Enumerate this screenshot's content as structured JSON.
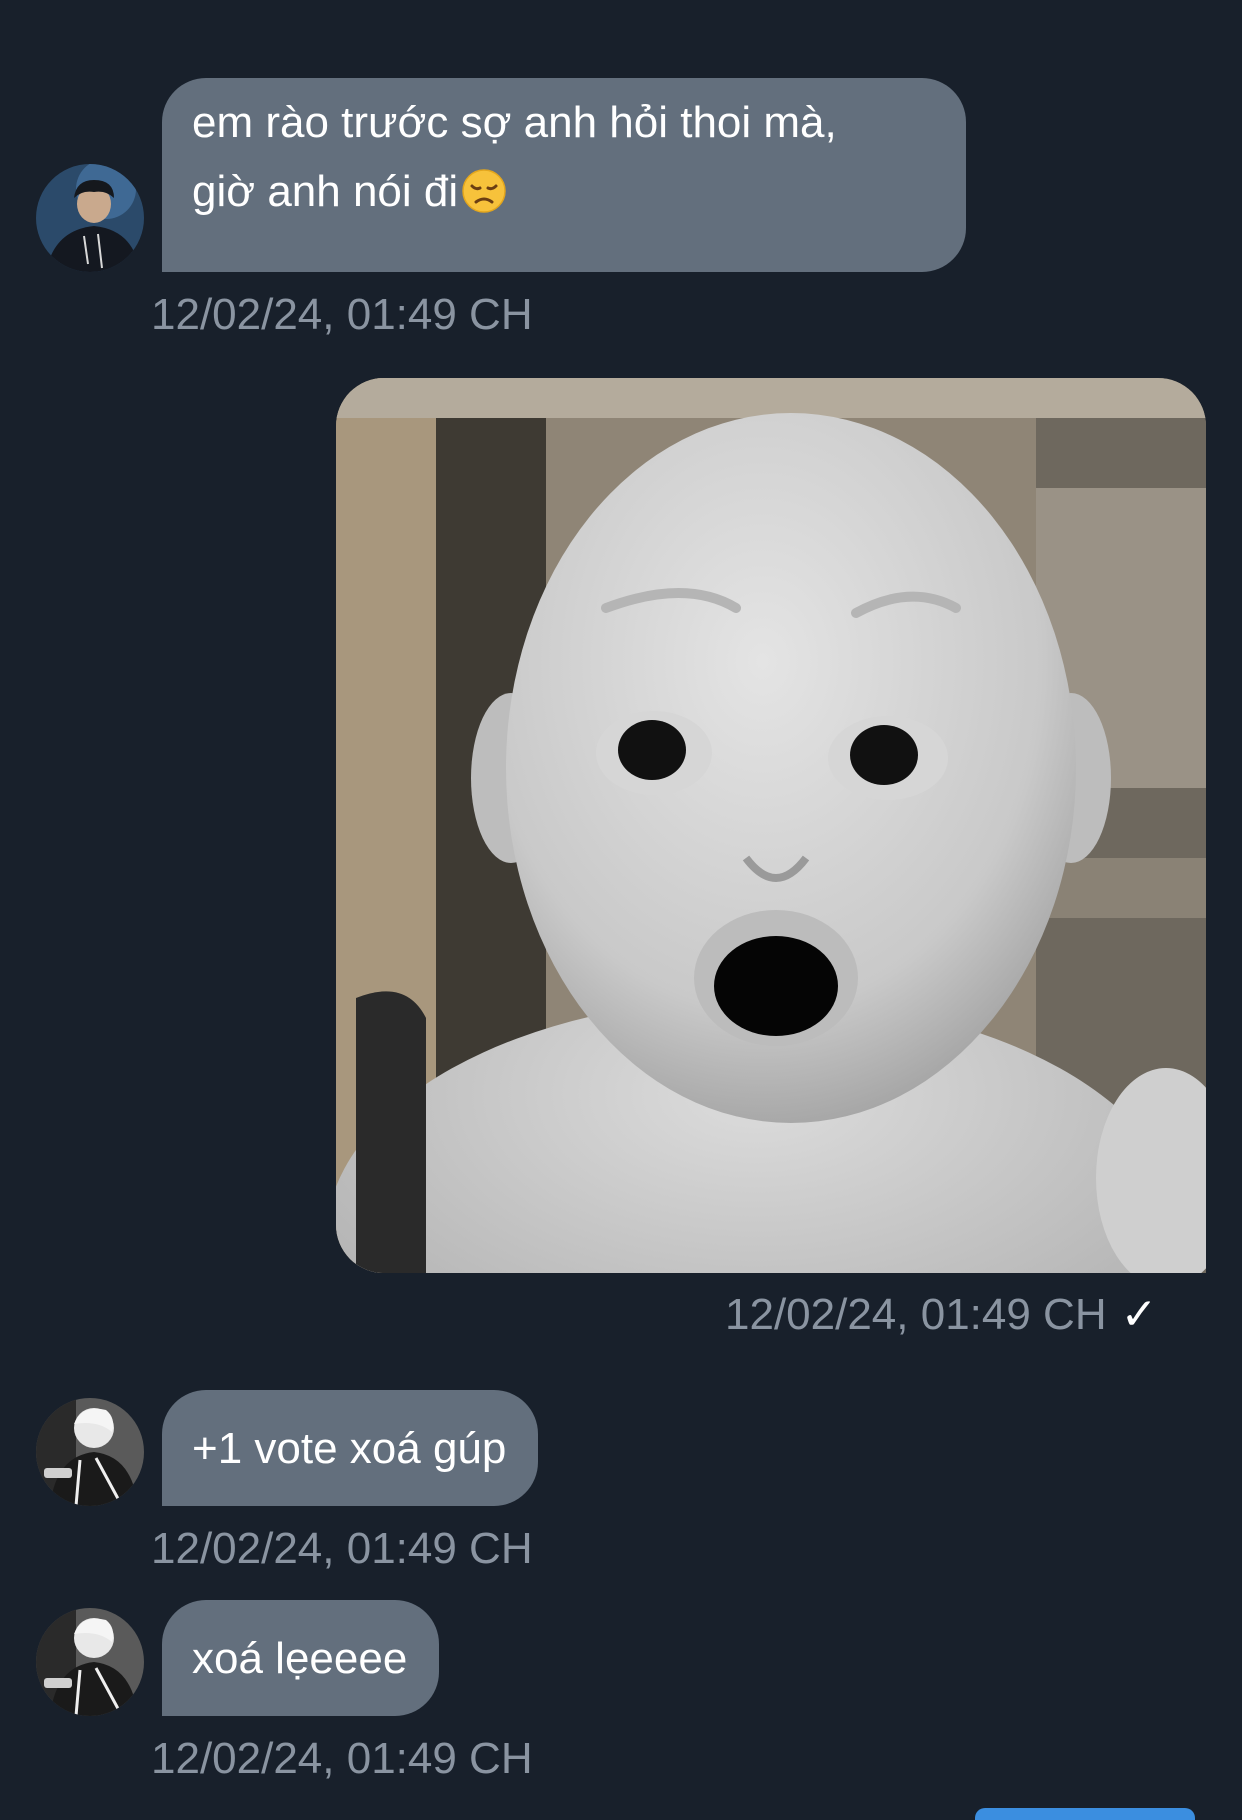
{
  "colors": {
    "background": "#18202b",
    "bubble_incoming": "#636f7d",
    "timestamp": "#8a94a1",
    "text": "#ffffff"
  },
  "messages": [
    {
      "direction": "incoming",
      "avatar": "avatar-player",
      "lines": [
        "em rào trước sợ anh hỏi thoi mà,",
        "giờ anh nói đi"
      ],
      "emoji": "disappointed-face-icon",
      "timestamp": "12/02/24, 01:49 CH"
    },
    {
      "direction": "outgoing",
      "type": "image",
      "image": "shocked-doll-meme",
      "timestamp": "12/02/24, 01:49 CH",
      "status_icon": "checkmark-icon",
      "status_mark": "✓"
    },
    {
      "direction": "incoming",
      "avatar": "avatar-grayscale",
      "text": "+1 vote xoá gúp",
      "timestamp": "12/02/24, 01:49 CH"
    },
    {
      "direction": "incoming",
      "avatar": "avatar-grayscale",
      "text": "xoá lẹeeee",
      "timestamp": "12/02/24, 01:49 CH"
    }
  ]
}
